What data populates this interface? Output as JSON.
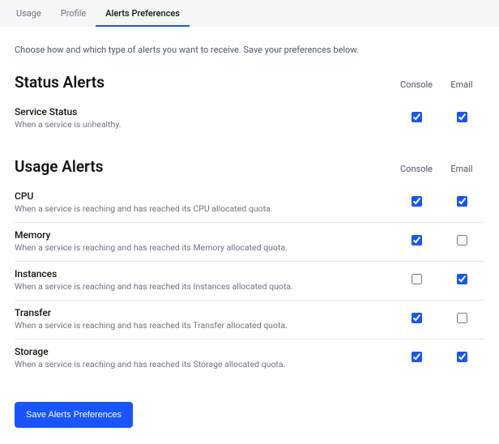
{
  "tabs": {
    "usage": "Usage",
    "profile": "Profile",
    "alerts": "Alerts Preferences"
  },
  "intro": "Choose how and which type of alerts you want to receive. Save your preferences below.",
  "columns": {
    "console": "Console",
    "email": "Email"
  },
  "status_section": {
    "title": "Status Alerts"
  },
  "status_alerts": [
    {
      "name": "Service Status",
      "desc": "When a service is unhealthy.",
      "console": true,
      "email": true
    }
  ],
  "usage_section": {
    "title": "Usage Alerts"
  },
  "usage_alerts": [
    {
      "name": "CPU",
      "desc": "When a service is reaching and has reached its CPU allocated quota.",
      "console": true,
      "email": true
    },
    {
      "name": "Memory",
      "desc": "When a service is reaching and has reached its Memory allocated quota.",
      "console": true,
      "email": false
    },
    {
      "name": "Instances",
      "desc": "When a service is reaching and has reached its Instances allocated quota.",
      "console": false,
      "email": true
    },
    {
      "name": "Transfer",
      "desc": "When a service is reaching and has reached its Transfer allocated quota.",
      "console": true,
      "email": false
    },
    {
      "name": "Storage",
      "desc": "When a service is reaching and has reached its Storage allocated quota.",
      "console": true,
      "email": true
    }
  ],
  "save_label": "Save Alerts Preferences"
}
